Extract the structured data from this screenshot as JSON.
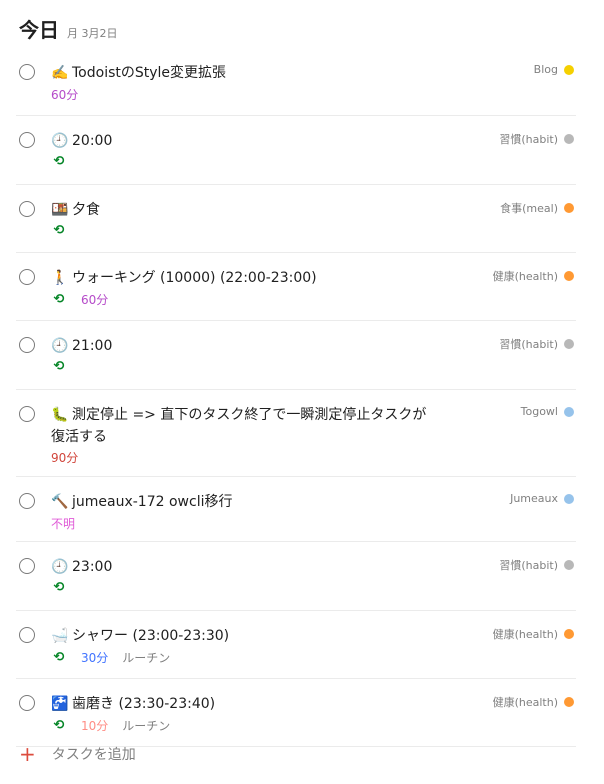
{
  "header": {
    "title": "今日",
    "date": "月 3月2日"
  },
  "tasks": [
    {
      "icon": "✍️",
      "icon_name": "writing-hand-icon",
      "title": "TodoistのStyle変更拡張",
      "recurring": false,
      "duration": "60分",
      "duration_color": "#b54ac9",
      "note": "",
      "project": "Blog",
      "project_color": "#f5d000"
    },
    {
      "icon": "🕘",
      "icon_name": "clock-icon",
      "title": "20:00",
      "recurring": true,
      "duration": "",
      "duration_color": "",
      "note": "",
      "project": "習慣(habit)",
      "project_color": "#b8b8b8"
    },
    {
      "icon": "🍱",
      "icon_name": "bento-icon",
      "title": "夕食",
      "recurring": true,
      "duration": "",
      "duration_color": "",
      "note": "",
      "project": "食事(meal)",
      "project_color": "#ff9933"
    },
    {
      "icon": "🚶",
      "icon_name": "walking-person-icon",
      "title": "ウォーキング (10000) (22:00-23:00)",
      "recurring": true,
      "duration": "60分",
      "duration_color": "#b54ac9",
      "note": "",
      "project": "健康(health)",
      "project_color": "#ff9933"
    },
    {
      "icon": "🕘",
      "icon_name": "clock-icon",
      "title": "21:00",
      "recurring": true,
      "duration": "",
      "duration_color": "",
      "note": "",
      "project": "習慣(habit)",
      "project_color": "#b8b8b8"
    },
    {
      "icon": "🐛",
      "icon_name": "worm-icon",
      "title": "測定停止 => 直下のタスク終了で一瞬測定停止タスクが",
      "title2": "復活する",
      "recurring": false,
      "duration": "90分",
      "duration_color": "#d1453b",
      "note": "",
      "project": "Togowl",
      "project_color": "#96c3eb"
    },
    {
      "icon": "🔨",
      "icon_name": "hammer-icon",
      "title": "jumeaux-172 owcli移行",
      "recurring": false,
      "duration": "不明",
      "duration_color": "#e05ad7",
      "note": "",
      "project": "Jumeaux",
      "project_color": "#96c3eb"
    },
    {
      "icon": "🕘",
      "icon_name": "clock-icon",
      "title": "23:00",
      "recurring": true,
      "duration": "",
      "duration_color": "",
      "note": "",
      "project": "習慣(habit)",
      "project_color": "#b8b8b8"
    },
    {
      "icon": "🛁",
      "icon_name": "bathtub-icon",
      "title": "シャワー (23:00-23:30)",
      "recurring": true,
      "duration": "30分",
      "duration_color": "#4073ff",
      "note": "ルーチン",
      "project": "健康(health)",
      "project_color": "#ff9933"
    },
    {
      "icon": "🚰",
      "icon_name": "faucet-icon",
      "title": "歯磨き (23:30-23:40)",
      "recurring": true,
      "duration": "10分",
      "duration_color": "#ff8d85",
      "note": "ルーチン",
      "project": "健康(health)",
      "project_color": "#ff9933"
    }
  ],
  "recur_icon": "⟲",
  "add_task": {
    "plus": "+",
    "label": "タスクを追加"
  }
}
